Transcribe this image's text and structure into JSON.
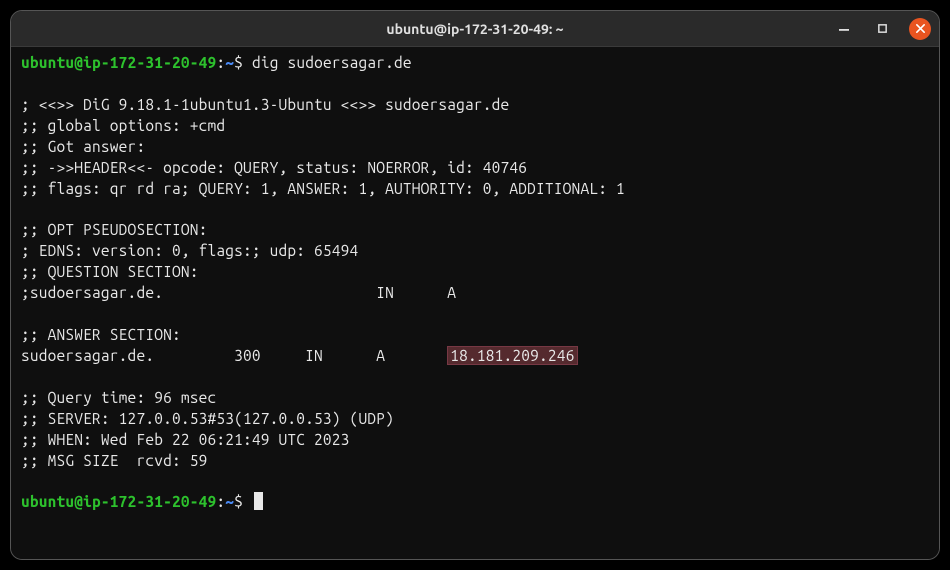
{
  "window": {
    "title": "ubuntu@ip-172-31-20-49: ~"
  },
  "prompt": {
    "user_host": "ubuntu@ip-172-31-20-49",
    "colon": ":",
    "path": "~",
    "dollar": "$"
  },
  "command": "dig sudoersagar.de",
  "output": {
    "banner": "; <<>> DiG 9.18.1-1ubuntu1.3-Ubuntu <<>> sudoersagar.de",
    "global_opts": ";; global options: +cmd",
    "got_answer": ";; Got answer:",
    "header": ";; ->>HEADER<<- opcode: QUERY, status: NOERROR, id: 40746",
    "flags": ";; flags: qr rd ra; QUERY: 1, ANSWER: 1, AUTHORITY: 0, ADDITIONAL: 1",
    "opt_section": ";; OPT PSEUDOSECTION:",
    "edns": "; EDNS: version: 0, flags:; udp: 65494",
    "question_hdr": ";; QUESTION SECTION:",
    "question_row": ";sudoersagar.de.                        IN      A",
    "answer_hdr": ";; ANSWER SECTION:",
    "answer_row_pre": "sudoersagar.de.         300     IN      A       ",
    "answer_ip": "18.181.209.246",
    "query_time": ";; Query time: 96 msec",
    "server": ";; SERVER: 127.0.0.53#53(127.0.0.53) (UDP)",
    "when": ";; WHEN: Wed Feb 22 06:21:49 UTC 2023",
    "msg_size": ";; MSG SIZE  rcvd: 59"
  }
}
